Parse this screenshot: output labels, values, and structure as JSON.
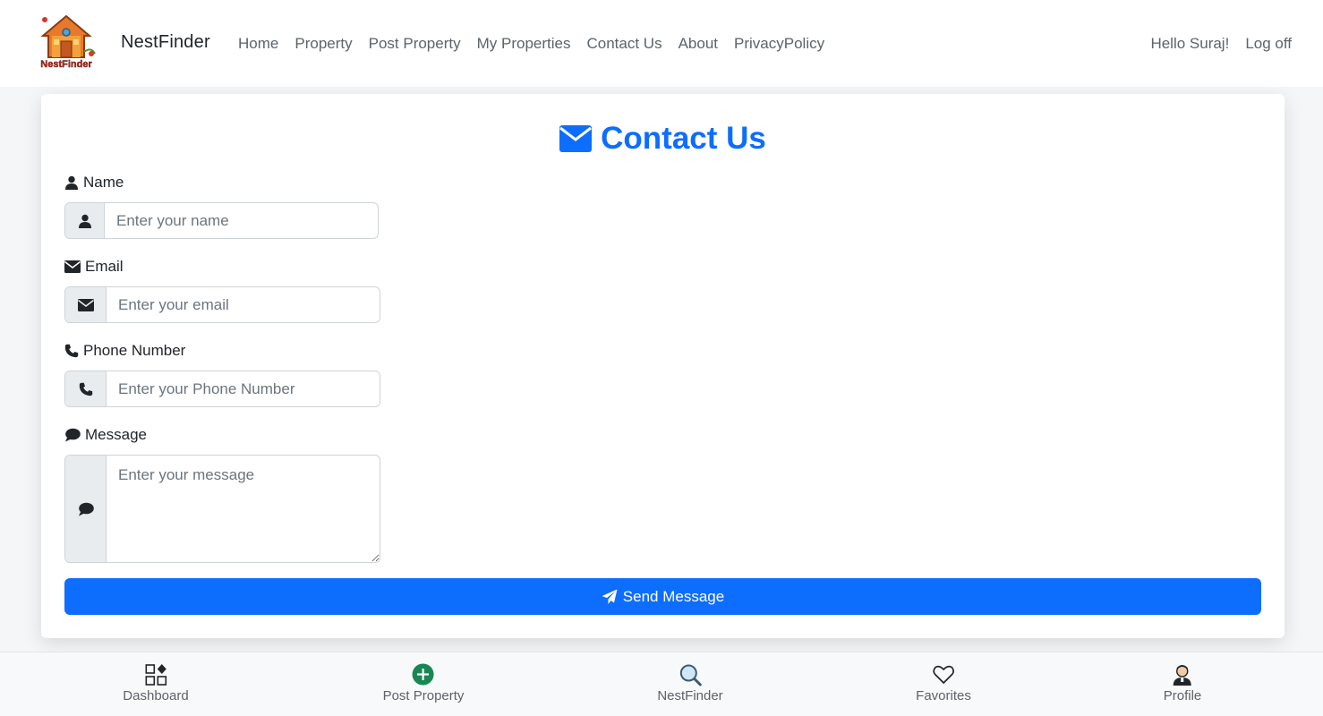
{
  "navbar": {
    "brand": "NestFinder",
    "logo_text": "NestFinder",
    "links": [
      "Home",
      "Property",
      "Post Property",
      "My Properties",
      "Contact Us",
      "About",
      "PrivacyPolicy"
    ],
    "greeting": "Hello Suraj!",
    "logout": "Log off"
  },
  "form": {
    "title": "Contact Us",
    "name_label": "Name",
    "name_placeholder": "Enter your name",
    "email_label": "Email",
    "email_placeholder": "Enter your email",
    "phone_label": "Phone Number",
    "phone_placeholder": "Enter your Phone Number",
    "message_label": "Message",
    "message_placeholder": "Enter your message",
    "submit_label": "Send Message"
  },
  "bottom_nav": {
    "dashboard": "Dashboard",
    "post_property": "Post Property",
    "nestfinder": "NestFinder",
    "favorites": "Favorites",
    "profile": "Profile"
  },
  "colors": {
    "primary": "#0d6efd",
    "success": "#198754",
    "nav_text": "#5c636a"
  }
}
